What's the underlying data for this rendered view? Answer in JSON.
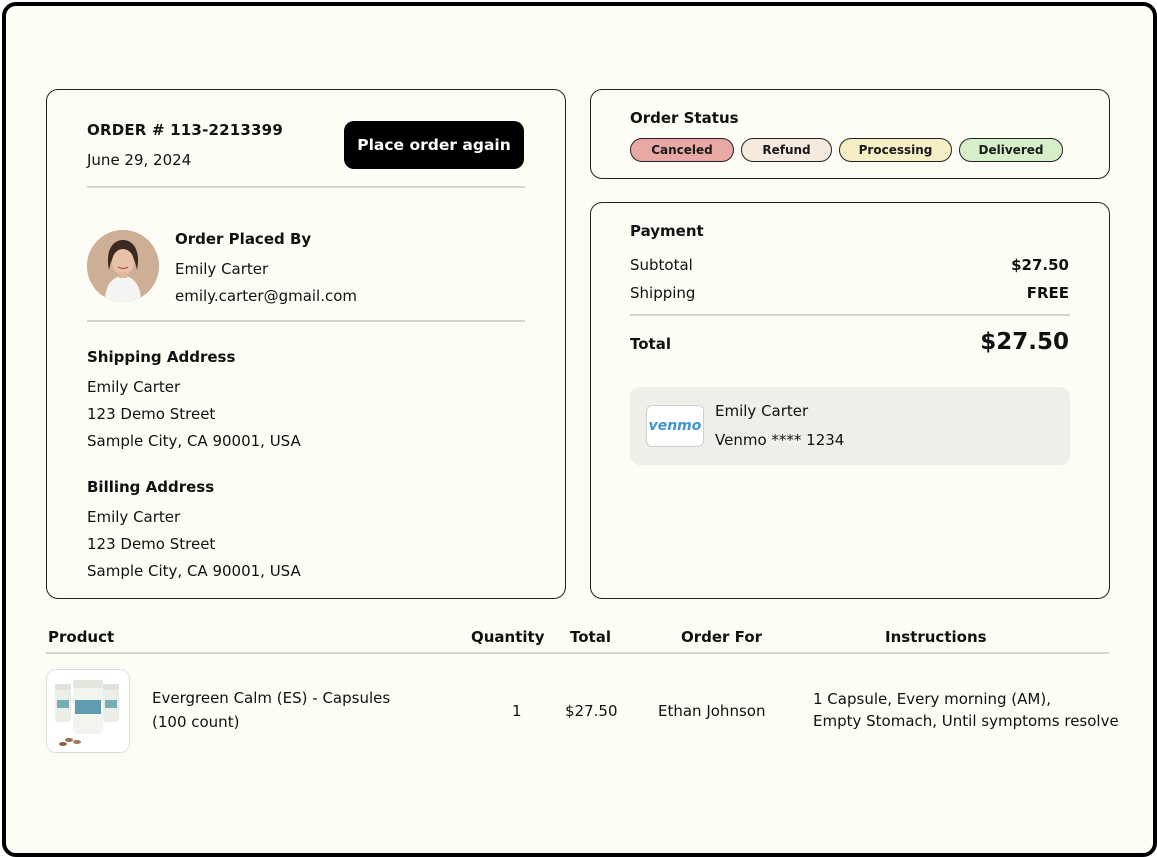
{
  "order": {
    "number": "ORDER # 113-2213399",
    "date": "June 29, 2024",
    "reorder_label": "Place order again",
    "placed_by_heading": "Order Placed By",
    "customer_name": "Emily Carter",
    "customer_email": "emily.carter@gmail.com",
    "shipping": {
      "heading": "Shipping Address",
      "name": "Emily Carter",
      "street": "123 Demo Street",
      "city": "Sample City, CA 90001, USA"
    },
    "billing": {
      "heading": "Billing Address",
      "name": "Emily Carter",
      "street": "123 Demo Street",
      "city": "Sample City, CA 90001, USA"
    }
  },
  "status": {
    "heading": "Order Status",
    "pills": [
      {
        "label": "Canceled",
        "color": "#e8a9a4"
      },
      {
        "label": "Refund",
        "color": "#f6eadf"
      },
      {
        "label": "Processing",
        "color": "#f7eec5"
      },
      {
        "label": "Delivered",
        "color": "#d6efc8"
      }
    ]
  },
  "payment": {
    "heading": "Payment",
    "subtotal_label": "Subtotal",
    "subtotal_value": "$27.50",
    "shipping_label": "Shipping",
    "shipping_value": "FREE",
    "total_label": "Total",
    "total_value": "$27.50",
    "method": {
      "logo_text": "venmo",
      "name": "Emily Carter",
      "account": "Venmo **** 1234",
      "brand_color": "#3d95ce"
    }
  },
  "table": {
    "headers": {
      "product": "Product",
      "quantity": "Quantity",
      "total": "Total",
      "order_for": "Order For",
      "instructions": "Instructions"
    },
    "rows": [
      {
        "product_line1": "Evergreen Calm (ES) - Capsules",
        "product_line2": "(100 count)",
        "quantity": "1",
        "total": "$27.50",
        "order_for": "Ethan Johnson",
        "instructions_line1": "1 Capsule, Every morning (AM),",
        "instructions_line2": "Empty Stomach, Until symptoms resolve"
      }
    ]
  }
}
